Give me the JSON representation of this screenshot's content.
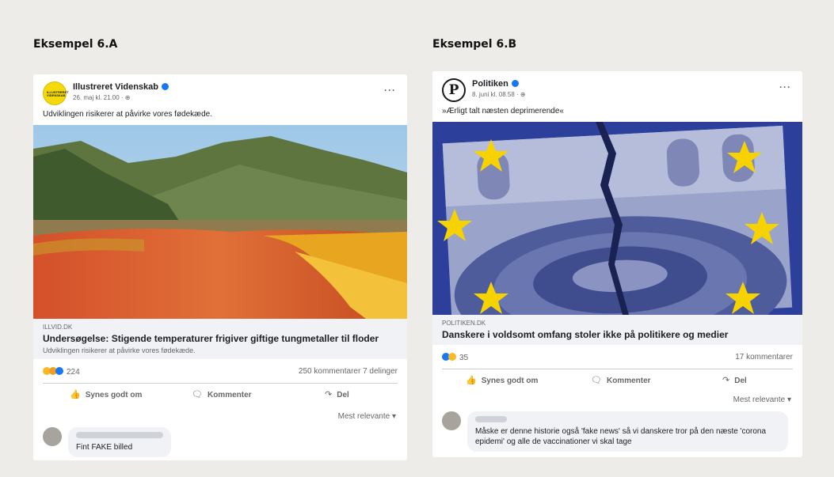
{
  "examples": [
    {
      "label": "Eksempel 6.A",
      "post": {
        "page_name": "Illustreret Videnskab",
        "timestamp": "26. maj kl. 21.00 · ⊕",
        "text": "Udviklingen risikerer at påvirke vores fødekæde.",
        "link_domain": "ILLVID.DK",
        "link_headline": "Undersøgelse: Stigende temperaturer frigiver giftige tungmetaller til floder",
        "link_description": "Udviklingen risikerer at påvirke vores fødekæde.",
        "reaction_count": "224",
        "comments_shares": "250 kommentarer  7 delinger",
        "like_label": "Synes godt om",
        "comment_label": "Kommenter",
        "share_label": "Del",
        "sort_label": "Mest relevante ▾",
        "comment_text": "Fint FAKE billed"
      }
    },
    {
      "label": "Eksempel 6.B",
      "post": {
        "page_name": "Politiken",
        "timestamp": "8. juni kl. 08.58 · ⊕",
        "text": "»Ærligt talt næsten deprimerende«",
        "link_domain": "POLITIKEN.DK",
        "link_headline": "Danskere i voldsomt omfang stoler ikke på politikere og medier",
        "reaction_count": "35",
        "comments_shares": "17 kommentarer",
        "like_label": "Synes godt om",
        "comment_label": "Kommenter",
        "share_label": "Del",
        "sort_label": "Mest relevante ▾",
        "comment_text": "Måske er denne historie også 'fake news' så vi danskere tror på den næste 'corona epidemi' og alle de vaccinationer vi skal tage"
      }
    }
  ],
  "colors": {
    "background": "#edece8",
    "facebook_blue": "#1877f2",
    "eu_blue": "#2c3f9a",
    "eu_star": "#f6d300"
  }
}
